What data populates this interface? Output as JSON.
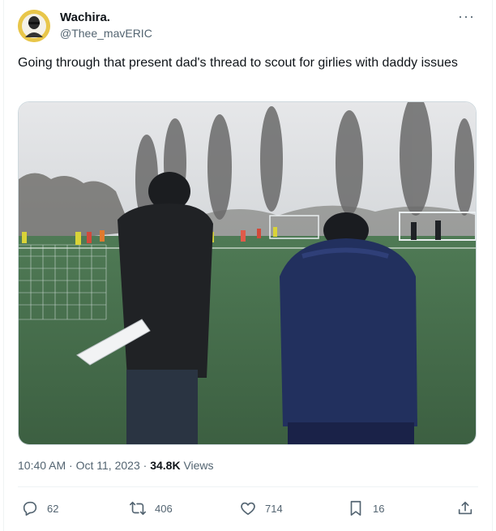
{
  "author": {
    "display_name": "Wachira.",
    "handle": "@Thee_mavERIC",
    "avatar_icon": "avatar-image"
  },
  "tweet": {
    "text": "Going through that present dad's thread to scout for girlies with daddy issues",
    "media_description": "photo of a football training pitch with two coaches watching from behind the goal"
  },
  "meta": {
    "time": "10:40 AM",
    "sep1": "·",
    "date": "Oct 11, 2023",
    "sep2": "·",
    "views_count": "34.8K",
    "views_label": "Views"
  },
  "actions": {
    "replies": "62",
    "reposts": "406",
    "likes": "714",
    "bookmarks": "16"
  },
  "colors": {
    "text": "#0f1419",
    "secondary": "#536471",
    "border": "#eff3f4"
  }
}
